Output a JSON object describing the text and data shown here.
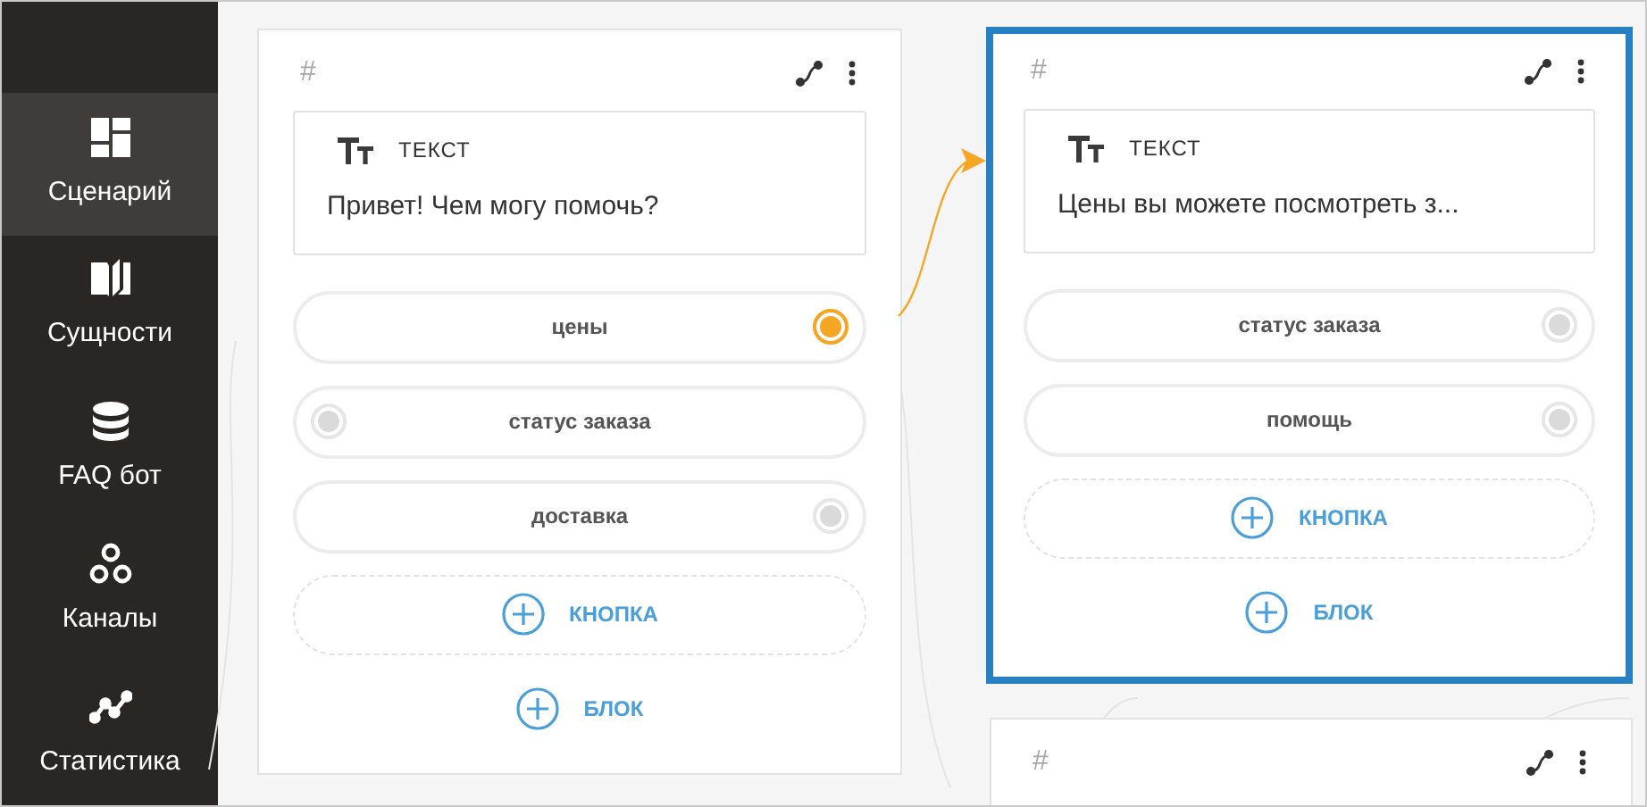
{
  "sidebar": {
    "items": [
      {
        "kind": "scenario",
        "label": "Сценарий",
        "selected": true
      },
      {
        "kind": "entities",
        "label": "Сущности",
        "selected": false
      },
      {
        "kind": "faq",
        "label": "FAQ бот",
        "selected": false
      },
      {
        "kind": "channels",
        "label": "Каналы",
        "selected": false
      },
      {
        "kind": "stats",
        "label": "Статистика",
        "selected": false
      }
    ]
  },
  "blocks": [
    {
      "hash": "#",
      "selected": false,
      "message": {
        "type_label": "ТЕКСТ",
        "text": "Привет! Чем могу помочь?"
      },
      "buttons": [
        {
          "label": "цены",
          "port_on_left": false,
          "connected": true
        },
        {
          "label": "статус заказа",
          "port_on_left": true,
          "connected": false
        },
        {
          "label": "доставка",
          "port_on_left": false,
          "connected": false
        }
      ],
      "add_button": "КНОПКА",
      "add_block": "БЛОК"
    },
    {
      "hash": "#",
      "selected": true,
      "message": {
        "type_label": "ТЕКСТ",
        "text": "Цены вы можете посмотреть з..."
      },
      "buttons": [
        {
          "label": "статус заказа",
          "port_on_left": false,
          "connected": false
        },
        {
          "label": "помощь",
          "port_on_left": false,
          "connected": false
        }
      ],
      "add_button": "КНОПКА",
      "add_block": "БЛОК"
    },
    {
      "hash": "#",
      "selected": false
    }
  ]
}
